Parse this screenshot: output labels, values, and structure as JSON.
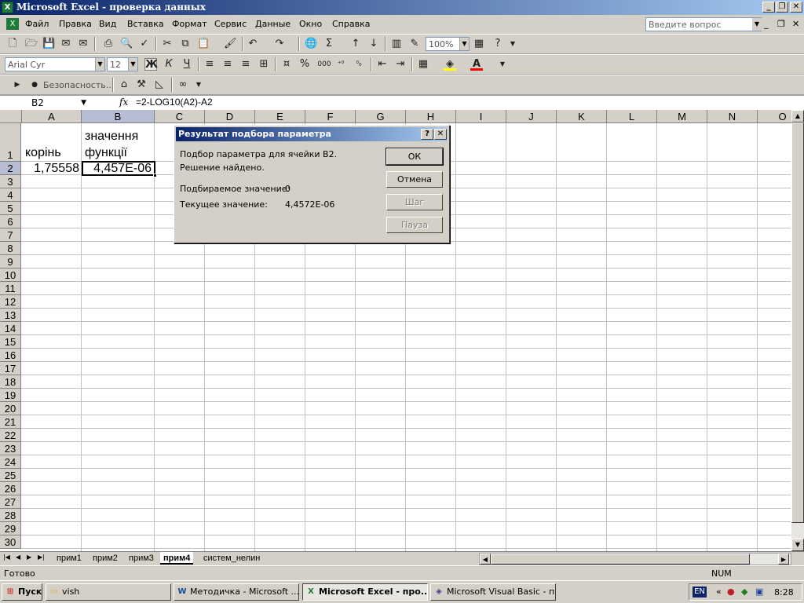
{
  "window": {
    "title": "Microsoft Excel - проверка данных",
    "help_placeholder": "Введите вопрос"
  },
  "menu": [
    "Файл",
    "Правка",
    "Вид",
    "Вставка",
    "Формат",
    "Сервис",
    "Данные",
    "Окно",
    "Справка"
  ],
  "toolbar": {
    "zoom": "100%",
    "font": "Arial Cyr",
    "size": "12",
    "bold": "Ж",
    "italic": "К",
    "underline": "Ч",
    "security": "Безопасность...",
    "percent": "%",
    "thousands": "000",
    "sigma": "Σ"
  },
  "formula_bar": {
    "name_box": "B2",
    "fx": "fx",
    "formula": "=2-LOG10(A2)-A2"
  },
  "columns": [
    "A",
    "B",
    "C",
    "D",
    "E",
    "F",
    "G",
    "H",
    "I",
    "J",
    "K",
    "L",
    "M",
    "N",
    "O"
  ],
  "rows": [
    "1",
    "2",
    "3",
    "4",
    "5",
    "6",
    "7",
    "8",
    "9",
    "10",
    "11",
    "12",
    "13",
    "14",
    "15",
    "16",
    "17",
    "18",
    "19",
    "20",
    "21",
    "22",
    "23",
    "24",
    "25",
    "26",
    "27",
    "28",
    "29",
    "30"
  ],
  "cells": {
    "A1": "корінь",
    "B1_line1": "значення",
    "B1_line2": "функції",
    "A2": "1,75558",
    "B2": "4,457E-06"
  },
  "dialog": {
    "title": "Результат подбора параметра",
    "line1": "Подбор параметра для ячейки B2.",
    "line2": "Решение найдено.",
    "target_label": "Подбираемое значение:",
    "target_value": "0",
    "current_label": "Текущее значение:",
    "current_value": "4,4572E-06",
    "ok": "ОК",
    "cancel": "Отмена",
    "step": "Шаг",
    "pause": "Пауза",
    "help_btn": "?",
    "close_btn": "✕"
  },
  "sheet_tabs": [
    "прим1",
    "прим2",
    "прим3",
    "прим4",
    "систем_нелин"
  ],
  "active_tab": "прим4",
  "status": {
    "left": "Готово",
    "num": "NUM"
  },
  "taskbar": {
    "start": "Пуск",
    "tasks": [
      "vish",
      "Методичка - Microsoft ...",
      "Microsoft Excel - про...",
      "Microsoft Visual Basic - п..."
    ],
    "lang": "EN",
    "clock": "8:28"
  }
}
